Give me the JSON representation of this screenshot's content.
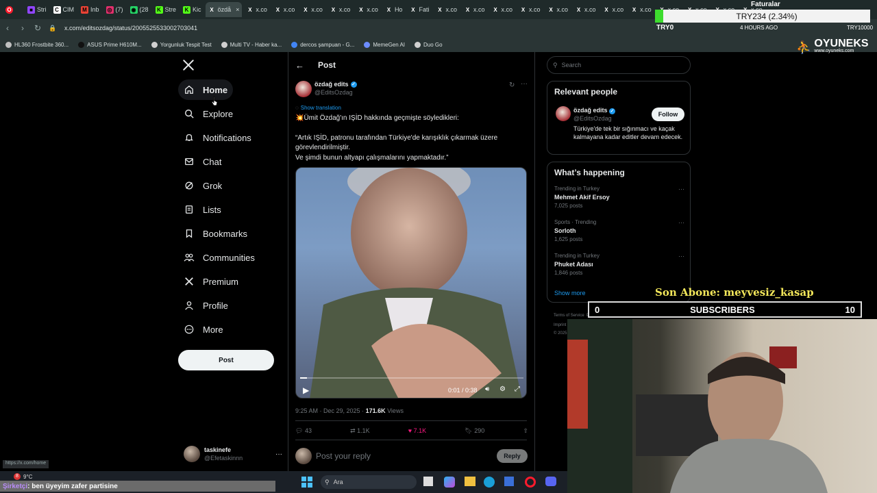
{
  "browser": {
    "tabs": [
      {
        "label": "Stri",
        "color": "#9146ff",
        "glyph": "■"
      },
      {
        "label": "CIM",
        "color": "#ffffff",
        "glyph": "C"
      },
      {
        "label": "Inb",
        "color": "#ea4335",
        "glyph": "M"
      },
      {
        "label": "(7)",
        "color": "#e1306c",
        "glyph": "◎"
      },
      {
        "label": "(28",
        "color": "#25d366",
        "glyph": "◉"
      },
      {
        "label": "Stre",
        "color": "#53fc18",
        "glyph": "K"
      },
      {
        "label": "Kic",
        "color": "#53fc18",
        "glyph": "K"
      },
      {
        "label": "özdå",
        "color": "#ffffff",
        "glyph": "X",
        "active": true
      },
      {
        "label": "x.co",
        "color": "#ffffff",
        "glyph": "X"
      },
      {
        "label": "x.co",
        "color": "#ffffff",
        "glyph": "X"
      },
      {
        "label": "x.co",
        "color": "#ffffff",
        "glyph": "X"
      },
      {
        "label": "x.co",
        "color": "#ffffff",
        "glyph": "X"
      },
      {
        "label": "x.co",
        "color": "#ffffff",
        "glyph": "X"
      },
      {
        "label": "Ho",
        "color": "#ffffff",
        "glyph": "X"
      },
      {
        "label": "Fati",
        "color": "#ffffff",
        "glyph": "X"
      },
      {
        "label": "x.co",
        "color": "#ffffff",
        "glyph": "X"
      },
      {
        "label": "x.co",
        "color": "#ffffff",
        "glyph": "X"
      },
      {
        "label": "x.co",
        "color": "#ffffff",
        "glyph": "X"
      },
      {
        "label": "x.co",
        "color": "#ffffff",
        "glyph": "X"
      },
      {
        "label": "x.co",
        "color": "#ffffff",
        "glyph": "X"
      },
      {
        "label": "x.co",
        "color": "#ffffff",
        "glyph": "X"
      },
      {
        "label": "x.co",
        "color": "#ffffff",
        "glyph": "X"
      },
      {
        "label": "x.co",
        "color": "#ffffff",
        "glyph": "X"
      },
      {
        "label": "x.co",
        "color": "#ffffff",
        "glyph": "X"
      },
      {
        "label": "x.co",
        "color": "#ffffff",
        "glyph": "X"
      },
      {
        "label": "x.co",
        "color": "#ffffff",
        "glyph": "X"
      },
      {
        "label": "x.co",
        "color": "#ffffff",
        "glyph": "X"
      }
    ],
    "close_tab": "×",
    "url": "x.com/editsozdag/status/2005525533002703041",
    "faturalar": "Faturalar",
    "try_ticker": "TRY234 (2.34%)",
    "try0": "TRY0",
    "hours_ago": "4 HOURS AGO",
    "try_right": "TRY10000",
    "bookmarks": [
      {
        "label": "HL360 Frostbite 360...",
        "color": "#c0c0c0"
      },
      {
        "label": "ASUS Prime H610M...",
        "color": "#111111"
      },
      {
        "label": "Yorgunluk Tespit Test",
        "color": "#d0d0d0"
      },
      {
        "label": "Multi TV - Haber ka...",
        "color": "#d0d0d0"
      },
      {
        "label": "dercos şampuan - G...",
        "color": "#4285f4"
      },
      {
        "label": "MemeGen AI",
        "color": "#6c8cff"
      },
      {
        "label": "Duo Go",
        "color": "#d0d0d0"
      }
    ]
  },
  "nav": {
    "items": [
      {
        "label": "Home",
        "icon": "home-icon",
        "active": true
      },
      {
        "label": "Explore",
        "icon": "search-icon"
      },
      {
        "label": "Notifications",
        "icon": "bell-icon"
      },
      {
        "label": "Chat",
        "icon": "mail-icon"
      },
      {
        "label": "Grok",
        "icon": "grok-icon"
      },
      {
        "label": "Lists",
        "icon": "list-icon"
      },
      {
        "label": "Bookmarks",
        "icon": "bookmark-icon"
      },
      {
        "label": "Communities",
        "icon": "people-icon"
      },
      {
        "label": "Premium",
        "icon": "x-icon"
      },
      {
        "label": "Profile",
        "icon": "person-icon"
      },
      {
        "label": "More",
        "icon": "more-icon"
      }
    ],
    "post_button": "Post",
    "account": {
      "name": "taskinefe",
      "handle": "@Efetaskinnn",
      "more": "···"
    }
  },
  "post": {
    "header": "Post",
    "author": "özdağ edits",
    "handle": "@EditsOzdag",
    "show_translation": "Show translation",
    "line1": "💥Ümit Özdağ'ın IŞİD hakkında geçmişte söyledikleri:",
    "quote1": "“Artık IŞİD, patronu tarafından Türkiye'de karışıklık çıkarmak üzere",
    "quote2": "görevlendirilmiştir.",
    "quote3": "Ve şimdi bunun altyapı çalışmalarını yapmaktadır.”",
    "video_time": "0:01 / 0:38",
    "video_progress": 0.03,
    "timestamp": "9:25 AM · Dec 29, 2025 · ",
    "views_count": "171.6K",
    "views_label": " Views",
    "replies": "43",
    "reposts": "1.1K",
    "likes": "7.1K",
    "bookmarks": "290",
    "reply_placeholder": "Post your reply",
    "reply_button": "Reply"
  },
  "right": {
    "search_placeholder": "Search",
    "relevant_title": "Relevant people",
    "person_name": "özdağ edits",
    "person_handle": "@EditsOzdag",
    "follow": "Follow",
    "bio": "Türkiye'de tek bir sığınmacı ve kaçak kalmayana kadar editler devam edecek.",
    "happening_title": "What’s happening",
    "trends": [
      {
        "context": "Trending in Turkey",
        "title": "Mehmet Akif Ersoy",
        "posts": "7,025 posts"
      },
      {
        "context": "Sports · Trending",
        "title": "Sorloth",
        "posts": "1,625 posts"
      },
      {
        "context": "Trending in Turkey",
        "title": "Phuket Adası",
        "posts": "1,846 posts"
      }
    ],
    "show_more": "Show more",
    "footer": "Terms of Service  Privacy Policy  Cookie Policy",
    "footer2": "Imprint",
    "footer3": "© 2025"
  },
  "overlay": {
    "brand": "OYUNEKS",
    "brand_url": "www.oyuneks.com",
    "son_abone": "Son Abone: meyvesiz_kasap",
    "subs_left": "0",
    "subs_label": "SUBSCRIBERS",
    "subs_right": "10",
    "status_url": "https://x.com/home",
    "chat_user": "Şirketçi",
    "chat_text": ": ben üyeyim zafer partisine",
    "weather": "9°C",
    "notif_count": "8",
    "taskbar_search": "Ara"
  }
}
